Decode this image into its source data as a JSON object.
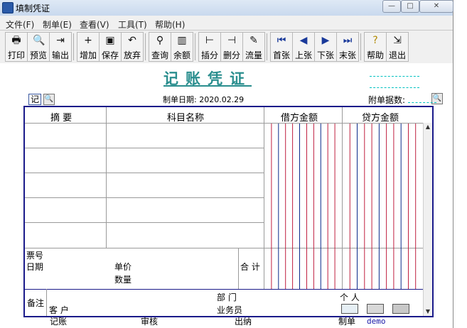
{
  "window": {
    "title": "填制凭证"
  },
  "menus": [
    "文件(F)",
    "制单(E)",
    "查看(V)",
    "工具(T)",
    "帮助(H)"
  ],
  "toolbar": {
    "print": "打印",
    "preview": "预览",
    "export": "输出",
    "add": "增加",
    "save": "保存",
    "discard": "放弃",
    "query": "查询",
    "balance": "余额",
    "insert": "插分",
    "delete": "删分",
    "flow": "流量",
    "first": "首张",
    "prev": "上张",
    "next": "下张",
    "last": "末张",
    "help": "帮助",
    "exit": "退出"
  },
  "voucher": {
    "title": "记账凭证",
    "word": "记",
    "date_label": "制单日期: 2020.02.29",
    "attachments_label": "附单据数:",
    "headers": {
      "summary": "摘 要",
      "account": "科目名称",
      "debit": "借方金额",
      "credit": "贷方金额"
    },
    "footer": {
      "ticket_no": "票号",
      "date": "日期",
      "unit_price": "单价",
      "quantity": "数量",
      "total": "合 计",
      "notes": "备注",
      "dept": "部 门",
      "person": "个 人",
      "customer": "客 户",
      "salesperson": "业务员"
    },
    "signatures": {
      "bookkeeping": "记账",
      "review": "审核",
      "cashier": "出纳",
      "preparer": "制单",
      "preparer_name": "demo"
    }
  }
}
